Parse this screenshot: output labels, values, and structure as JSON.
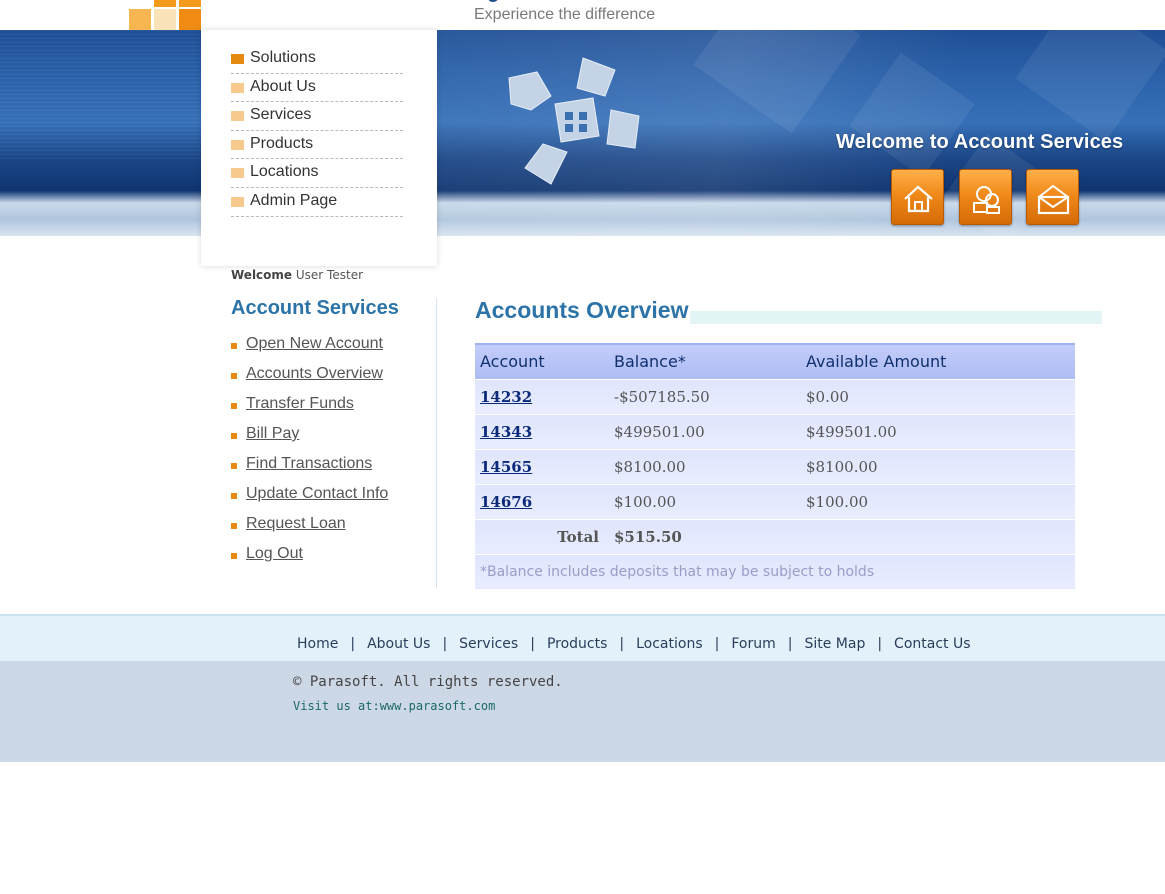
{
  "brand": {
    "tagline": "Experience the difference",
    "colors": {
      "accent_orange": "#e48a12",
      "light_orange": "#f7c98c",
      "title_blue": "#2c74a8",
      "header_blue": "#1f4f96"
    }
  },
  "top_nav": {
    "items": [
      {
        "label": "Solutions",
        "active": true
      },
      {
        "label": "About Us"
      },
      {
        "label": "Services"
      },
      {
        "label": "Products"
      },
      {
        "label": "Locations"
      },
      {
        "label": "Admin Page"
      }
    ]
  },
  "hero": {
    "welcome": "Welcome to Account Services",
    "buttons": [
      {
        "icon": "home-icon"
      },
      {
        "icon": "contacts-icon"
      },
      {
        "icon": "mail-icon"
      }
    ]
  },
  "user": {
    "welcome_label": "Welcome",
    "name": "User Tester"
  },
  "account_services": {
    "title": "Account Services",
    "links": [
      "Open New Account",
      "Accounts Overview",
      "Transfer Funds",
      "Bill Pay",
      "Find Transactions",
      "Update Contact Info",
      "Request Loan",
      "Log Out"
    ]
  },
  "overview": {
    "title": "Accounts Overview",
    "columns": [
      "Account",
      "Balance*",
      "Available Amount"
    ],
    "rows": [
      {
        "account": "14232",
        "balance": "-$507185.50",
        "available": "$0.00"
      },
      {
        "account": "14343",
        "balance": "$499501.00",
        "available": "$499501.00"
      },
      {
        "account": "14565",
        "balance": "$8100.00",
        "available": "$8100.00"
      },
      {
        "account": "14676",
        "balance": "$100.00",
        "available": "$100.00"
      }
    ],
    "total_label": "Total",
    "total_value": "$515.50",
    "note": "*Balance includes deposits that may be subject to holds"
  },
  "footer": {
    "links": [
      "Home",
      "About Us",
      "Services",
      "Products",
      "Locations",
      "Forum",
      "Site Map",
      "Contact Us"
    ],
    "separator": "|",
    "copyright": "© Parasoft. All rights reserved.",
    "visit": "Visit us at:www.parasoft.com"
  }
}
